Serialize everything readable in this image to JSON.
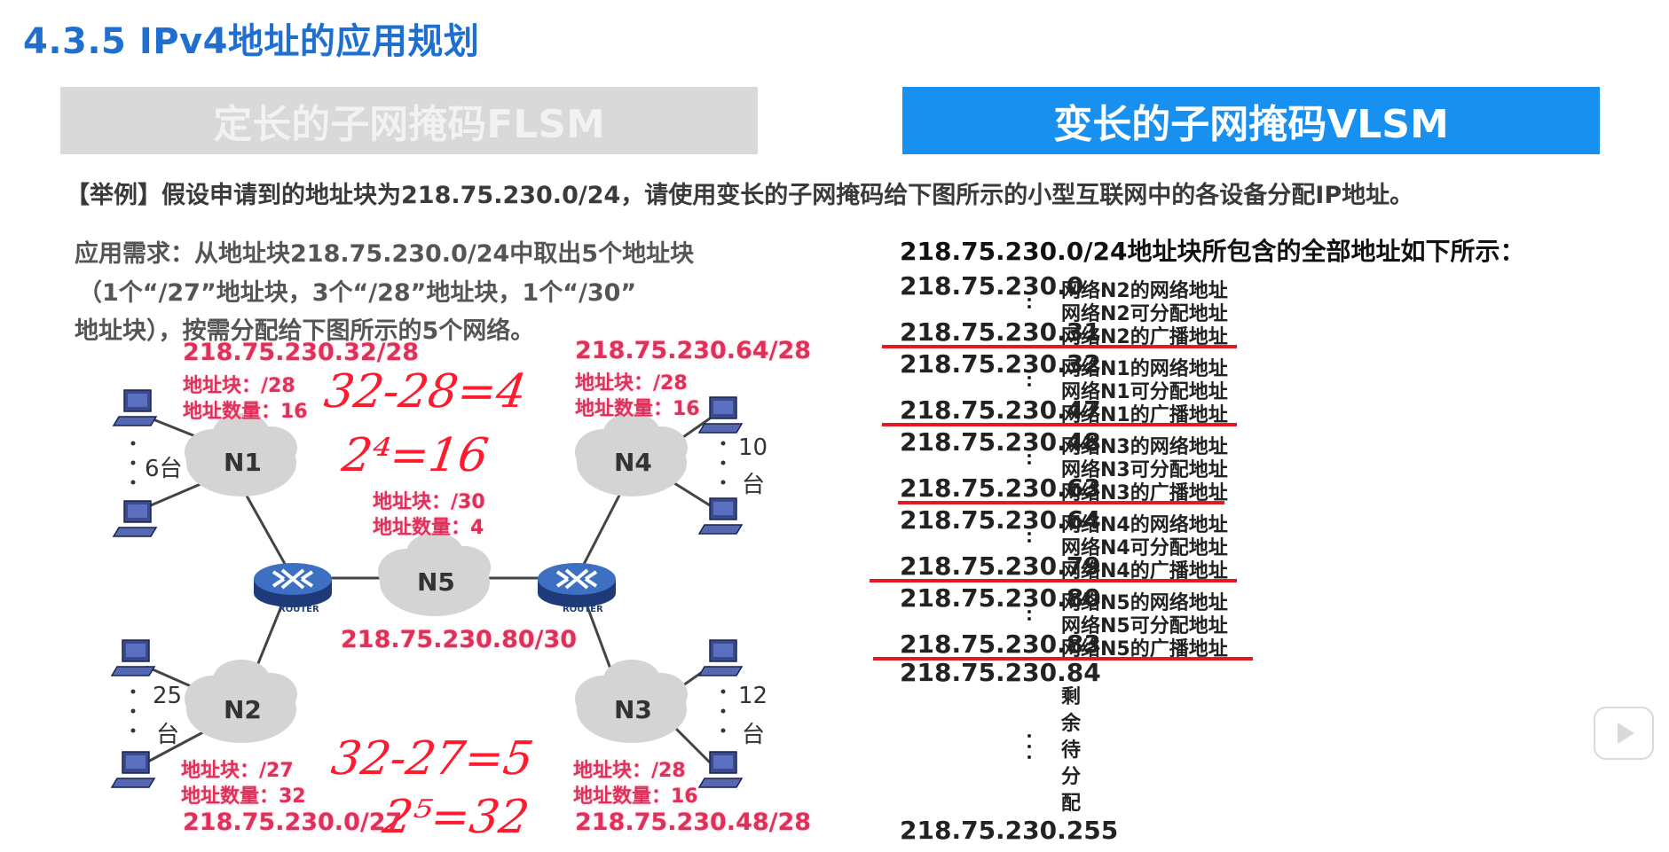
{
  "title": "4.3.5 IPv4地址的应用规划",
  "tabs": {
    "flsm": "定长的子网掩码FLSM",
    "vlsm": "变长的子网掩码VLSM"
  },
  "example": "【举例】假设申请到的地址块为218.75.230.0/24，请使用变长的子网掩码给下图所示的小型互联网中的各设备分配IP地址。",
  "requirement": {
    "line1": "应用需求：从地址块218.75.230.0/24中取出5个地址块",
    "line2": "（1个“/27”地址块，3个“/28”地址块，1个“/30”",
    "line3": "地址块），按需分配给下图所示的5个网络。"
  },
  "networks": {
    "n1": {
      "label": "N1",
      "ip": "218.75.230.32/28",
      "block": "地址块：/28",
      "count": "地址数量：16",
      "hosts": "6台"
    },
    "n4": {
      "label": "N4",
      "ip": "218.75.230.64/28",
      "block": "地址块：/28",
      "count": "地址数量：16",
      "hosts1": "10",
      "hosts2": "台"
    },
    "n5": {
      "label": "N5",
      "ip": "218.75.230.80/30",
      "block": "地址块：/30",
      "count": "地址数量：4"
    },
    "n2": {
      "label": "N2",
      "ip": "218.75.230.0/27",
      "block": "地址块：/27",
      "count": "地址数量：32",
      "hosts1": "25",
      "hosts2": "台"
    },
    "n3": {
      "label": "N3",
      "ip": "218.75.230.48/28",
      "block": "地址块：/28",
      "count": "地址数量：16",
      "hosts1": "12",
      "hosts2": "台"
    }
  },
  "router_label": "ROUTER",
  "handwriting": {
    "h1": "32-28=4",
    "h2": "2⁴=16",
    "h3": "32-27=5",
    "h4": "2⁵=32"
  },
  "address_list": {
    "heading": "218.75.230.0/24地址块所包含的全部地址如下所示：",
    "rows": [
      {
        "addr": "218.75.230.0",
        "desc": "网络N2的网络地址"
      },
      {
        "addr": "",
        "desc": "网络N2可分配地址"
      },
      {
        "addr": "218.75.230.31",
        "desc": "网络N2的广播地址"
      },
      {
        "addr": "218.75.230.32",
        "desc": "网络N1的网络地址"
      },
      {
        "addr": "",
        "desc": "网络N1可分配地址"
      },
      {
        "addr": "218.75.230.47",
        "desc": "网络N1的广播地址"
      },
      {
        "addr": "218.75.230.48",
        "desc": "网络N3的网络地址"
      },
      {
        "addr": "",
        "desc": "网络N3可分配地址"
      },
      {
        "addr": "218.75.230.63",
        "desc": "网络N3的广播地址"
      },
      {
        "addr": "218.75.230.64",
        "desc": "网络N4的网络地址"
      },
      {
        "addr": "",
        "desc": "网络N4可分配地址"
      },
      {
        "addr": "218.75.230.79",
        "desc": "网络N4的广播地址"
      },
      {
        "addr": "218.75.230.80",
        "desc": "网络N5的网络地址"
      },
      {
        "addr": "",
        "desc": "网络N5可分配地址"
      },
      {
        "addr": "218.75.230.83",
        "desc": "网络N5的广播地址"
      }
    ],
    "addr_84": "218.75.230.84",
    "remaining": [
      "剩",
      "余",
      "待",
      "分",
      "配"
    ],
    "addr_255": "218.75.230.255"
  },
  "colors": {
    "title": "#1e6fd0",
    "vlsm_tab": "#1890f0",
    "flsm_tab": "#d9d9d9",
    "annotation": "#e0305a",
    "handwriting": "#ff1a2e",
    "underline": "#e01b24"
  }
}
